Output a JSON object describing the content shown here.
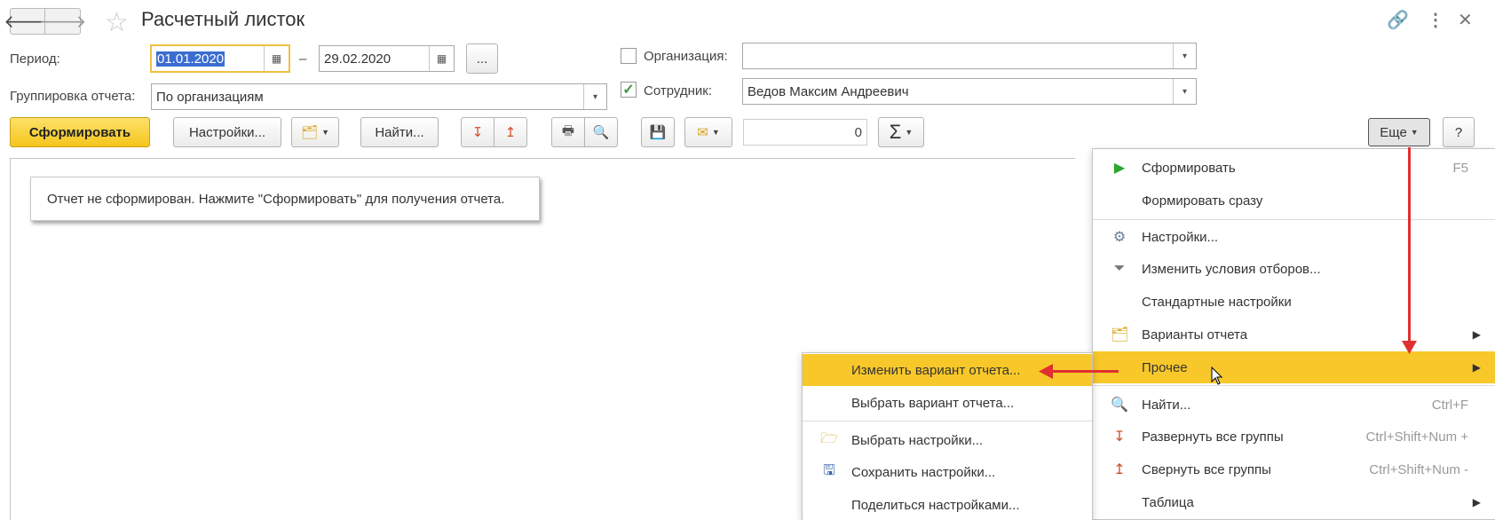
{
  "title": "Расчетный листок",
  "form": {
    "period_label": "Период:",
    "date_from": "01.01.2020",
    "date_to": "29.02.2020",
    "dash": "–",
    "more_dots": "...",
    "grouping_label": "Группировка отчета:",
    "grouping_value": "По организациям",
    "org_label": "Организация:",
    "org_value": "",
    "employee_label": "Сотрудник:",
    "employee_value": "Ведов Максим Андреевич"
  },
  "toolbar": {
    "generate": "Сформировать",
    "settings": "Настройки...",
    "find": "Найти...",
    "sum_value": "0",
    "more": "Еще",
    "help": "?"
  },
  "report_message": "Отчет не сформирован. Нажмите \"Сформировать\" для получения отчета.",
  "main_menu": [
    {
      "label": "Сформировать",
      "shortcut": "F5",
      "icon": "play-icon"
    },
    {
      "label": "Формировать сразу",
      "shortcut": "",
      "icon": ""
    },
    {
      "label": "Настройки...",
      "shortcut": "",
      "icon": "settings-gear-icon"
    },
    {
      "label": "Изменить условия отборов...",
      "shortcut": "",
      "icon": "filter-icon"
    },
    {
      "label": "Стандартные настройки",
      "shortcut": "",
      "icon": ""
    },
    {
      "label": "Варианты отчета",
      "shortcut": "",
      "icon": "report-variants-icon",
      "submenu": true
    },
    {
      "label": "Прочее",
      "shortcut": "",
      "icon": "",
      "submenu": true,
      "highlighted": true
    },
    {
      "label": "Найти...",
      "shortcut": "Ctrl+F",
      "icon": "search-icon"
    },
    {
      "label": "Развернуть все группы",
      "shortcut": "Ctrl+Shift+Num +",
      "icon": "expand-groups-icon"
    },
    {
      "label": "Свернуть все группы",
      "shortcut": "Ctrl+Shift+Num -",
      "icon": "collapse-groups-icon"
    },
    {
      "label": "Таблица",
      "shortcut": "",
      "icon": "",
      "submenu": true
    }
  ],
  "sub_menu": [
    {
      "label": "Изменить вариант отчета...",
      "icon": "",
      "highlighted": true
    },
    {
      "label": "Выбрать вариант отчета...",
      "icon": ""
    },
    {
      "label": "Выбрать настройки...",
      "icon": "folder-settings-icon"
    },
    {
      "label": "Сохранить настройки...",
      "icon": "save-settings-icon"
    },
    {
      "label": "Поделиться настройками...",
      "icon": ""
    }
  ],
  "colors": {
    "accent_yellow": "#f8c82a",
    "annotation_red": "#e03030",
    "selection_blue": "#3b6dd1"
  }
}
